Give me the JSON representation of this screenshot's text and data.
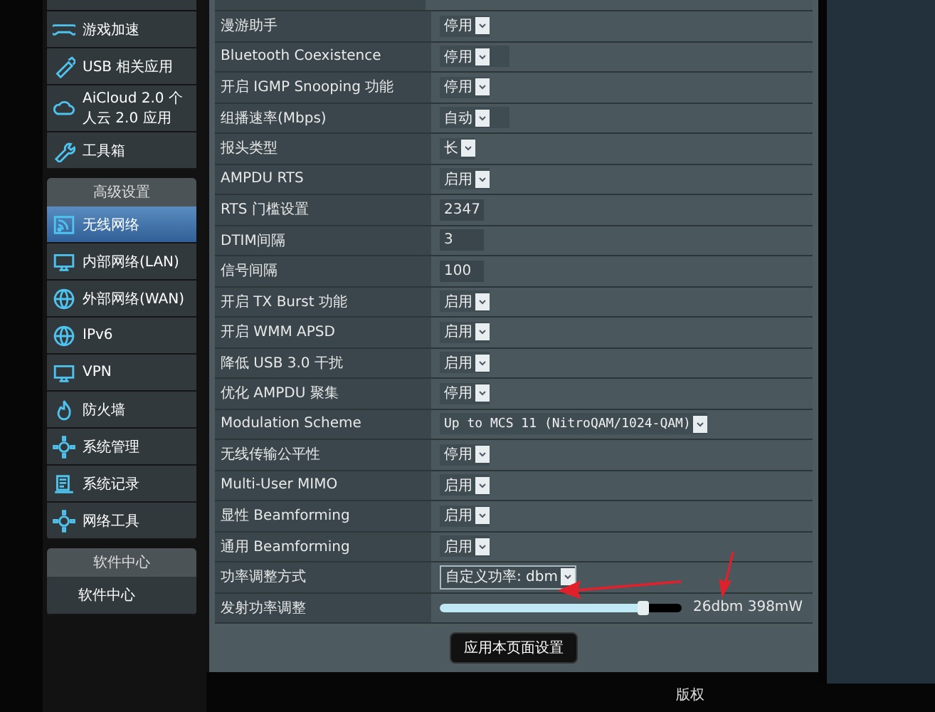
{
  "sidebar": {
    "top_items": [
      {
        "label": "游戏加速"
      },
      {
        "label": "USB 相关应用"
      },
      {
        "label": "AiCloud 2.0 个人云 2.0 应用"
      },
      {
        "label": "工具箱"
      }
    ],
    "sections": [
      {
        "title": "高级设置",
        "items": [
          {
            "label": "无线网络",
            "selected": true
          },
          {
            "label": "内部网络(LAN)",
            "selected": false
          },
          {
            "label": "外部网络(WAN)",
            "selected": false
          },
          {
            "label": "IPv6",
            "selected": false
          },
          {
            "label": "VPN",
            "selected": false
          },
          {
            "label": "防火墙",
            "selected": false
          },
          {
            "label": "系统管理",
            "selected": false
          },
          {
            "label": "系统记录",
            "selected": false
          },
          {
            "label": "网络工具",
            "selected": false
          }
        ]
      },
      {
        "title": "软件中心",
        "items": [
          {
            "label": "软件中心",
            "selected": false
          }
        ]
      }
    ]
  },
  "settings": [
    {
      "label": "漫游助手",
      "kind": "select",
      "value": "停用"
    },
    {
      "label": "Bluetooth Coexistence",
      "kind": "select",
      "value": "停用"
    },
    {
      "label": "开启 IGMP Snooping 功能",
      "kind": "select",
      "value": "停用"
    },
    {
      "label": "组播速率(Mbps)",
      "kind": "select",
      "value": "自动"
    },
    {
      "label": "报头类型",
      "kind": "select",
      "value": "长"
    },
    {
      "label": "AMPDU RTS",
      "kind": "select",
      "value": "启用"
    },
    {
      "label": "RTS 门槛设置",
      "kind": "input",
      "value": "2347"
    },
    {
      "label": "DTIM间隔",
      "kind": "input",
      "value": "3"
    },
    {
      "label": "信号间隔",
      "kind": "input",
      "value": "100"
    },
    {
      "label": "开启 TX Burst 功能",
      "kind": "select",
      "value": "启用"
    },
    {
      "label": "开启 WMM APSD",
      "kind": "select",
      "value": "启用"
    },
    {
      "label": "降低 USB 3.0 干扰",
      "kind": "select",
      "value": "启用"
    },
    {
      "label": "优化 AMPDU 聚集",
      "kind": "select",
      "value": "停用"
    },
    {
      "label": "Modulation Scheme",
      "kind": "select",
      "value": "Up to MCS 11 (NitroQAM/1024-QAM)"
    },
    {
      "label": "无线传输公平性",
      "kind": "select",
      "value": "停用"
    },
    {
      "label": "Multi-User MIMO",
      "kind": "select",
      "value": "启用"
    },
    {
      "label": "显性 Beamforming",
      "kind": "select",
      "value": "启用"
    },
    {
      "label": "通用 Beamforming",
      "kind": "select",
      "value": "启用"
    },
    {
      "label": "功率调整方式",
      "kind": "select",
      "value": "自定义功率: dbm",
      "focused": true
    },
    {
      "label": "发射功率调整",
      "kind": "slider",
      "level": 0.84,
      "reading": "26dbm 398mW"
    }
  ],
  "apply_button": "应用本页面设置",
  "footer": "版权"
}
